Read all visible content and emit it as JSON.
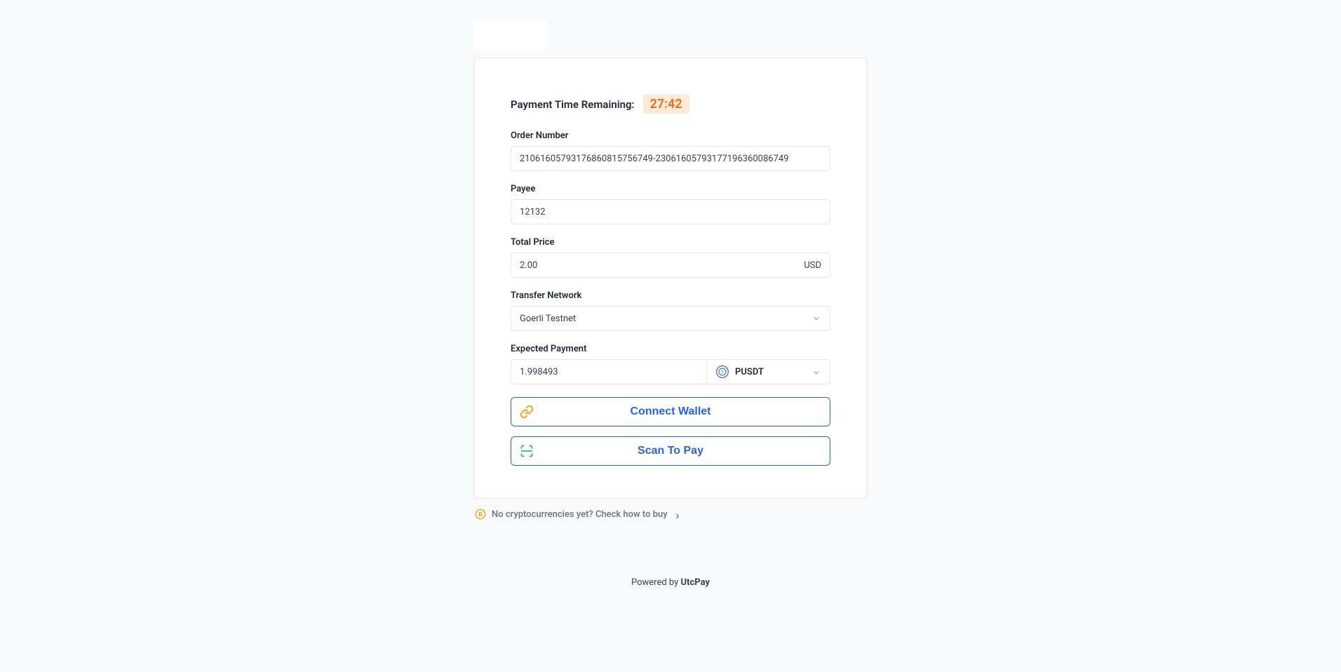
{
  "timer": {
    "label": "Payment Time Remaining:",
    "value": "27:42"
  },
  "fields": {
    "orderNumber": {
      "label": "Order Number",
      "value": "21061605793176860815756749-23061605793177196360086749"
    },
    "payee": {
      "label": "Payee",
      "value": "12132"
    },
    "totalPrice": {
      "label": "Total Price",
      "value": "2.00",
      "suffix": "USD"
    },
    "transferNetwork": {
      "label": "Transfer Network",
      "value": "Goerli Testnet"
    },
    "expectedPayment": {
      "label": "Expected Payment",
      "value": "1.998493",
      "currency": "PUSDT"
    }
  },
  "buttons": {
    "connectWallet": "Connect Wallet",
    "scanToPay": "Scan To Pay"
  },
  "footer": {
    "linkText": "No cryptocurrencies yet? Check how to buy",
    "poweredBy": "Powered by ",
    "brand": "UtcPay"
  }
}
